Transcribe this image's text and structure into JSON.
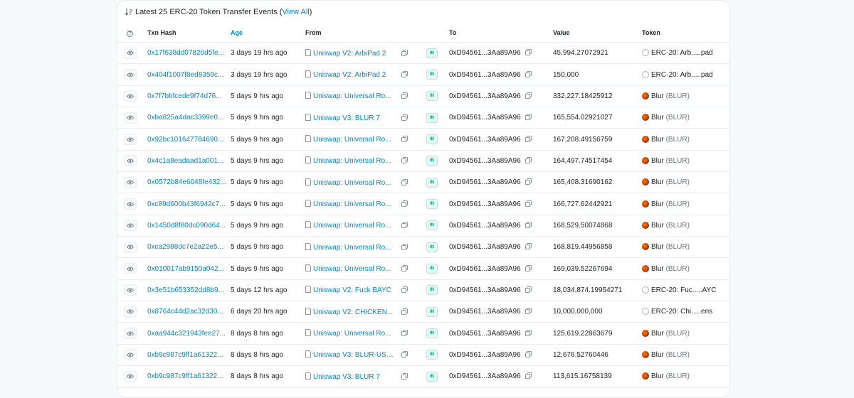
{
  "header": {
    "title": "Latest 25 ERC-20 Token Transfer Events",
    "open_paren": "(",
    "view_all": "View All",
    "close_paren": ")"
  },
  "columns": {
    "help": "?",
    "hash": "Txn Hash",
    "age": "Age",
    "from": "From",
    "to": "To",
    "value": "Value",
    "token": "Token"
  },
  "direction_label": "IN",
  "rows": [
    {
      "hash": "0x17f638dd07820d5fe...",
      "age": "3 days 19 hrs ago",
      "from": "Uniswap V2: ArbiPad 2",
      "to": "0xD94561...3Aa89A96",
      "value": "45,994.27072921",
      "token_name": "ERC-20: Arb.....pad",
      "token_symbol": "",
      "token_logo": "erc"
    },
    {
      "hash": "0x404f1007f8ed8359c...",
      "age": "3 days 19 hrs ago",
      "from": "Uniswap V2: ArbiPad 2",
      "to": "0xD94561...3Aa89A96",
      "value": "150,000",
      "token_name": "ERC-20: Arb.....pad",
      "token_symbol": "",
      "token_logo": "erc"
    },
    {
      "hash": "0x7f7bbfcede9f74d76...",
      "age": "5 days 9 hrs ago",
      "from": "Uniswap: Universal Ro...",
      "to": "0xD94561...3Aa89A96",
      "value": "332,227.18425912",
      "token_name": "Blur",
      "token_symbol": "(BLUR)",
      "token_logo": "blur"
    },
    {
      "hash": "0xba825a4dac3399e0...",
      "age": "5 days 9 hrs ago",
      "from": "Uniswap V3: BLUR 7",
      "to": "0xD94561...3Aa89A96",
      "value": "165,554.02921027",
      "token_name": "Blur",
      "token_symbol": "(BLUR)",
      "token_logo": "blur"
    },
    {
      "hash": "0x92bc101647784690...",
      "age": "5 days 9 hrs ago",
      "from": "Uniswap: Universal Ro...",
      "to": "0xD94561...3Aa89A96",
      "value": "167,208.49156759",
      "token_name": "Blur",
      "token_symbol": "(BLUR)",
      "token_logo": "blur"
    },
    {
      "hash": "0x4c1a8eadaad1a001...",
      "age": "5 days 9 hrs ago",
      "from": "Uniswap: Universal Ro...",
      "to": "0xD94561...3Aa89A96",
      "value": "164,497.74517454",
      "token_name": "Blur",
      "token_symbol": "(BLUR)",
      "token_logo": "blur"
    },
    {
      "hash": "0x0572b84e6048fe432...",
      "age": "5 days 9 hrs ago",
      "from": "Uniswap: Universal Ro...",
      "to": "0xD94561...3Aa89A96",
      "value": "165,408.31690162",
      "token_name": "Blur",
      "token_symbol": "(BLUR)",
      "token_logo": "blur"
    },
    {
      "hash": "0xc89d600b43f6942c7...",
      "age": "5 days 9 hrs ago",
      "from": "Uniswap: Universal Ro...",
      "to": "0xD94561...3Aa89A96",
      "value": "166,727.62442921",
      "token_name": "Blur",
      "token_symbol": "(BLUR)",
      "token_logo": "blur"
    },
    {
      "hash": "0x1450d8f80dc090d64...",
      "age": "5 days 9 hrs ago",
      "from": "Uniswap: Universal Ro...",
      "to": "0xD94561...3Aa89A96",
      "value": "168,529.50074868",
      "token_name": "Blur",
      "token_symbol": "(BLUR)",
      "token_logo": "blur"
    },
    {
      "hash": "0xca2988dc7e2a22e5...",
      "age": "5 days 9 hrs ago",
      "from": "Uniswap: Universal Ro...",
      "to": "0xD94561...3Aa89A96",
      "value": "168,819.44956858",
      "token_name": "Blur",
      "token_symbol": "(BLUR)",
      "token_logo": "blur"
    },
    {
      "hash": "0x010017ab9150a042...",
      "age": "5 days 9 hrs ago",
      "from": "Uniswap: Universal Ro...",
      "to": "0xD94561...3Aa89A96",
      "value": "169,039.52267694",
      "token_name": "Blur",
      "token_symbol": "(BLUR)",
      "token_logo": "blur"
    },
    {
      "hash": "0x3e51b653352dd8b9...",
      "age": "5 days 12 hrs ago",
      "from": "Uniswap V2: Fuck BAYC",
      "to": "0xD94561...3Aa89A96",
      "value": "18,034,874.19954271",
      "token_name": "ERC-20: Fuc.....AYC",
      "token_symbol": "",
      "token_logo": "erc"
    },
    {
      "hash": "0x8764c44d2ac32d30...",
      "age": "6 days 20 hrs ago",
      "from": "Uniswap V2: CHICKEN...",
      "to": "0xD94561...3Aa89A96",
      "value": "10,000,000,000",
      "token_name": "ERC-20: Chi.....ens",
      "token_symbol": "",
      "token_logo": "erc"
    },
    {
      "hash": "0xaa944c321943fee27...",
      "age": "8 days 8 hrs ago",
      "from": "Uniswap: Universal Ro...",
      "to": "0xD94561...3Aa89A96",
      "value": "125,619.22863679",
      "token_name": "Blur",
      "token_symbol": "(BLUR)",
      "token_logo": "blur"
    },
    {
      "hash": "0xb9c987c9ff1a61322...",
      "age": "8 days 8 hrs ago",
      "from": "Uniswap V3: BLUR-USD...",
      "to": "0xD94561...3Aa89A96",
      "value": "12,676.52760446",
      "token_name": "Blur",
      "token_symbol": "(BLUR)",
      "token_logo": "blur"
    },
    {
      "hash": "0xb9c987c9ff1a61322...",
      "age": "8 days 8 hrs ago",
      "from": "Uniswap V3: BLUR 7",
      "to": "0xD94561...3Aa89A96",
      "value": "113,615.16758139",
      "token_name": "Blur",
      "token_symbol": "(BLUR)",
      "token_logo": "blur"
    }
  ]
}
